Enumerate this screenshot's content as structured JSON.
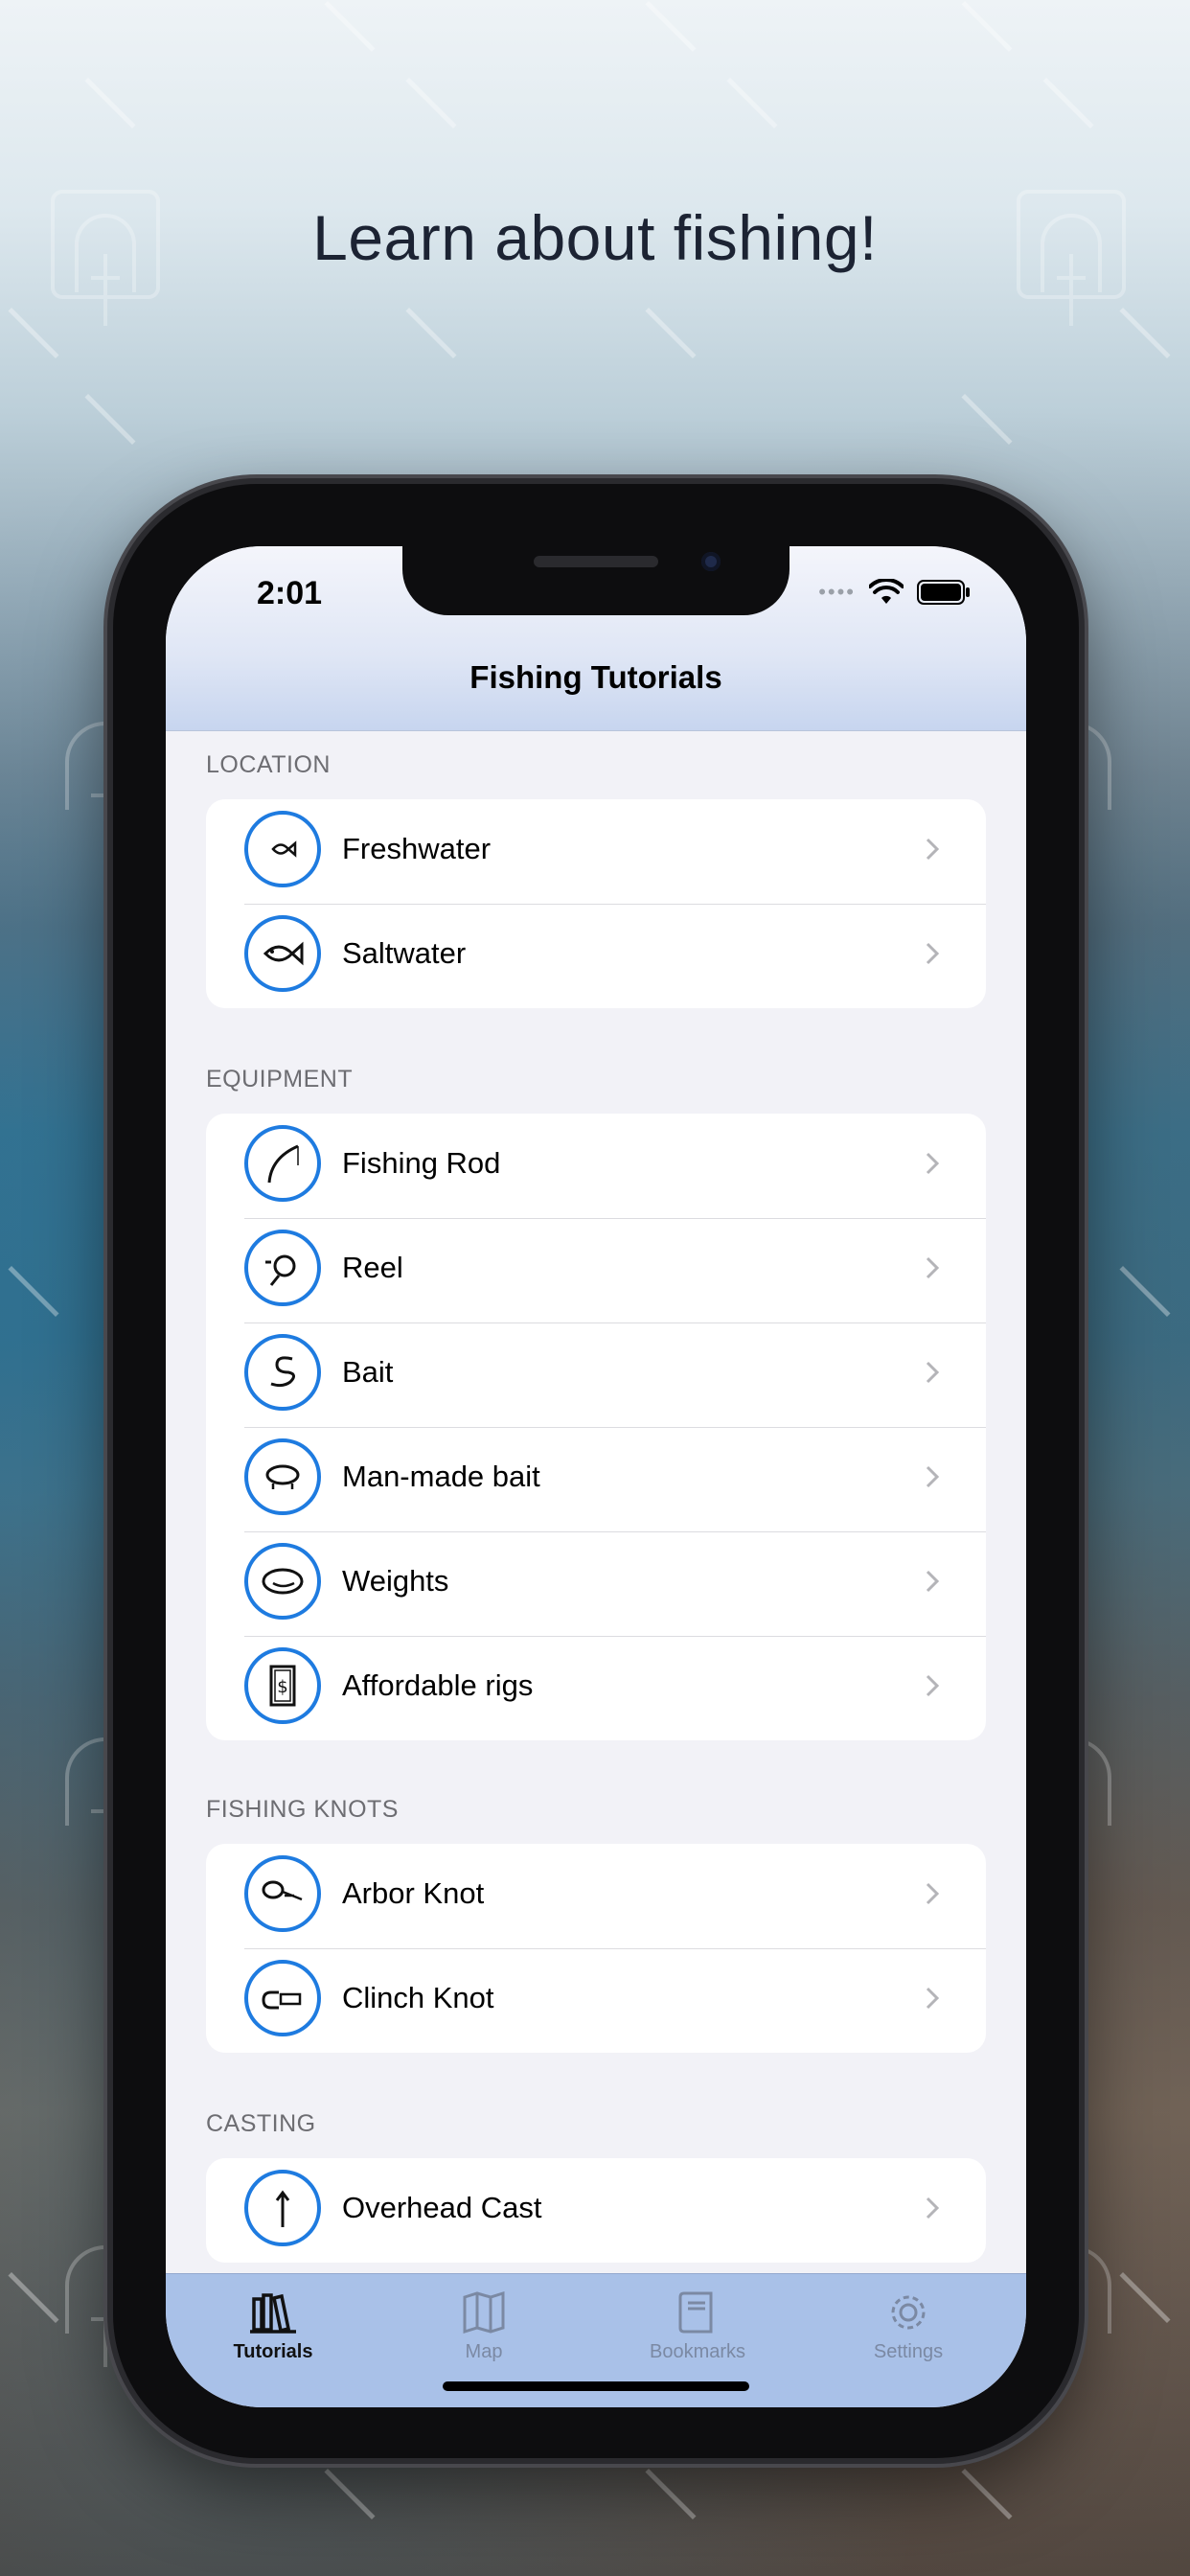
{
  "headline": "Learn about fishing!",
  "status_bar": {
    "time": "2:01"
  },
  "nav": {
    "title": "Fishing Tutorials"
  },
  "colors": {
    "accent": "#1e7be0",
    "tabbar": "#a9c1e8",
    "navbar": "#c7d5ef"
  },
  "sections": [
    {
      "header": "LOCATION",
      "items": [
        {
          "label": "Freshwater",
          "icon": "small-fish-icon"
        },
        {
          "label": "Saltwater",
          "icon": "fish-icon"
        }
      ]
    },
    {
      "header": "EQUIPMENT",
      "items": [
        {
          "label": "Fishing Rod",
          "icon": "rod-icon"
        },
        {
          "label": "Reel",
          "icon": "reel-icon"
        },
        {
          "label": "Bait",
          "icon": "worm-icon"
        },
        {
          "label": "Man-made bait",
          "icon": "lure-icon"
        },
        {
          "label": "Weights",
          "icon": "weight-icon"
        },
        {
          "label": "Affordable rigs",
          "icon": "dollar-icon"
        }
      ]
    },
    {
      "header": "FISHING KNOTS",
      "items": [
        {
          "label": "Arbor Knot",
          "icon": "arbor-knot-icon"
        },
        {
          "label": "Clinch Knot",
          "icon": "clinch-knot-icon"
        }
      ]
    },
    {
      "header": "CASTING",
      "items": [
        {
          "label": "Overhead Cast",
          "icon": "arrow-up-icon"
        }
      ]
    }
  ],
  "tabs": [
    {
      "label": "Tutorials",
      "icon": "books-icon",
      "active": true
    },
    {
      "label": "Map",
      "icon": "map-icon",
      "active": false
    },
    {
      "label": "Bookmarks",
      "icon": "book-icon",
      "active": false
    },
    {
      "label": "Settings",
      "icon": "gear-icon",
      "active": false
    }
  ]
}
